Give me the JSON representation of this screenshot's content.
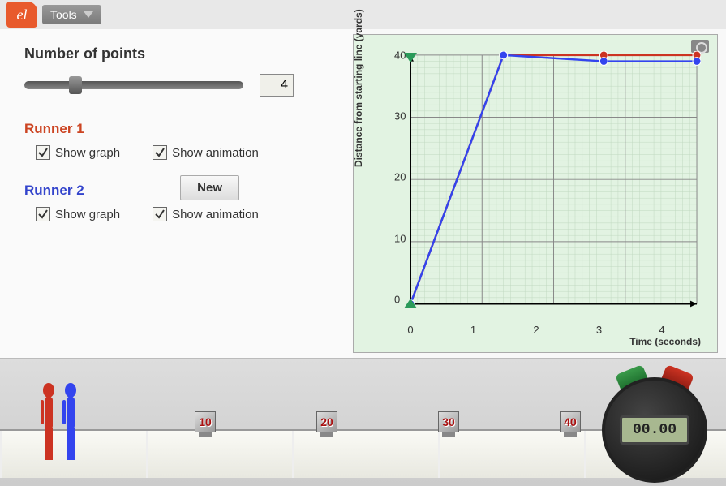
{
  "toolbar": {
    "tools_label": "Tools"
  },
  "controls": {
    "points_label": "Number of points",
    "points_value": "4",
    "runner1_label": "Runner 1",
    "runner2_label": "Runner 2",
    "show_graph_label": "Show graph",
    "show_animation_label": "Show animation",
    "new_label": "New"
  },
  "chart_data": {
    "type": "line",
    "xlabel": "Time (seconds)",
    "ylabel": "Distance from starting line (yards)",
    "xlim": [
      0,
      4
    ],
    "ylim": [
      0,
      40
    ],
    "x_ticks": [
      0,
      1,
      2,
      3,
      4
    ],
    "y_ticks": [
      0,
      10,
      20,
      30,
      40
    ],
    "series": [
      {
        "name": "Runner 1",
        "color": "#cc3322",
        "x": [
          0,
          1.3,
          2.7,
          4
        ],
        "y": [
          0,
          40,
          40,
          40
        ]
      },
      {
        "name": "Runner 2",
        "color": "#3344ee",
        "x": [
          0,
          1.3,
          2.7,
          4
        ],
        "y": [
          0,
          40,
          39,
          39
        ]
      }
    ]
  },
  "track": {
    "markers": [
      "10",
      "20",
      "30",
      "40"
    ],
    "stopwatch_value": "00.00"
  },
  "colors": {
    "runner1": "#cc3322",
    "runner2": "#3344ee",
    "accent_green": "#2a9a5a"
  }
}
